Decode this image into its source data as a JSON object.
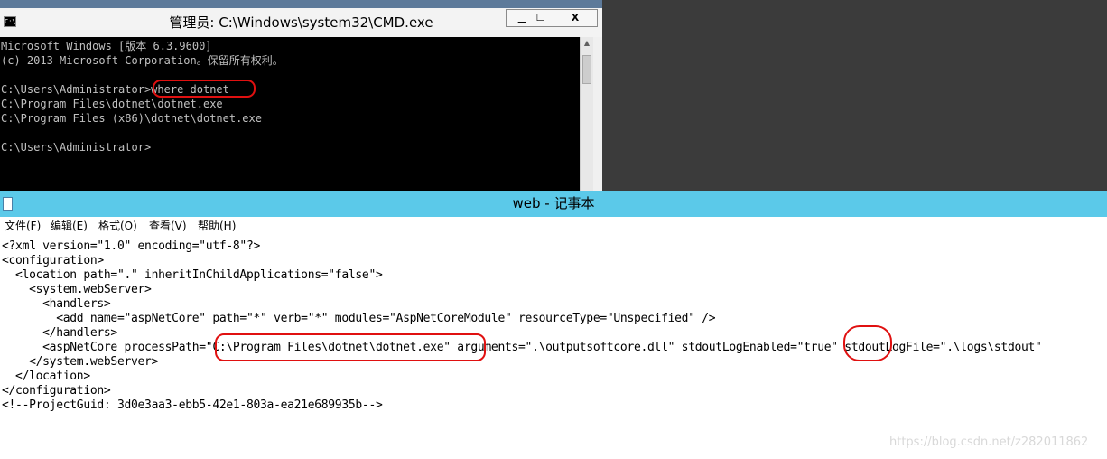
{
  "cmd_window": {
    "title": "管理员: C:\\Windows\\system32\\CMD.exe",
    "icon": "cmd-icon",
    "icon_glyph": "C:\\",
    "minimize_label": "▁",
    "maximize_label": "☐",
    "close_label": "X",
    "lines": [
      "Microsoft Windows [版本 6.3.9600]",
      "(c) 2013 Microsoft Corporation。保留所有权利。",
      "",
      "C:\\Users\\Administrator>where dotnet",
      "C:\\Program Files\\dotnet\\dotnet.exe",
      "C:\\Program Files (x86)\\dotnet\\dotnet.exe",
      "",
      "C:\\Users\\Administrator>"
    ]
  },
  "notepad": {
    "title": "web - 记事本",
    "icon": "notepad-icon",
    "menu": [
      "文件(F)",
      "编辑(E)",
      "格式(O)",
      "查看(V)",
      "帮助(H)"
    ],
    "lines": [
      "<?xml version=\"1.0\" encoding=\"utf-8\"?>",
      "<configuration>",
      "  <location path=\".\" inheritInChildApplications=\"false\">",
      "    <system.webServer>",
      "      <handlers>",
      "        <add name=\"aspNetCore\" path=\"*\" verb=\"*\" modules=\"AspNetCoreModule\" resourceType=\"Unspecified\" />",
      "      </handlers>",
      "      <aspNetCore processPath=\"C:\\Program Files\\dotnet\\dotnet.exe\" arguments=\".\\outputsoftcore.dll\" stdoutLogEnabled=\"true\" stdoutLogFile=\".\\logs\\stdout\"",
      "    </system.webServer>",
      "  </location>",
      "</configuration>",
      "<!--ProjectGuid: 3d0e3aa3-ebb5-42e1-803a-ea21e689935b-->"
    ]
  },
  "watermark": "https://blog.csdn.net/z282011862",
  "colors": {
    "notepad_titlebar": "#5bc9e9",
    "annotation_red": "#e01010",
    "console_bg": "#000000",
    "console_text": "#c0c0c0"
  }
}
